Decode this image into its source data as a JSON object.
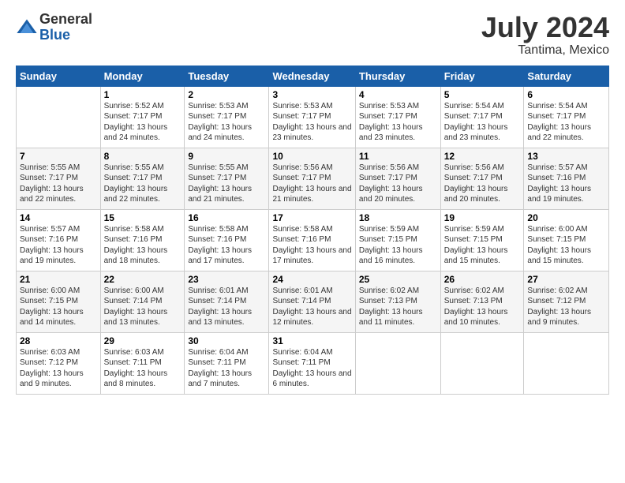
{
  "logo": {
    "general": "General",
    "blue": "Blue"
  },
  "title": {
    "month_year": "July 2024",
    "location": "Tantima, Mexico"
  },
  "headers": [
    "Sunday",
    "Monday",
    "Tuesday",
    "Wednesday",
    "Thursday",
    "Friday",
    "Saturday"
  ],
  "weeks": [
    [
      {
        "day": "",
        "sunrise": "",
        "sunset": "",
        "daylight": ""
      },
      {
        "day": "1",
        "sunrise": "Sunrise: 5:52 AM",
        "sunset": "Sunset: 7:17 PM",
        "daylight": "Daylight: 13 hours and 24 minutes."
      },
      {
        "day": "2",
        "sunrise": "Sunrise: 5:53 AM",
        "sunset": "Sunset: 7:17 PM",
        "daylight": "Daylight: 13 hours and 24 minutes."
      },
      {
        "day": "3",
        "sunrise": "Sunrise: 5:53 AM",
        "sunset": "Sunset: 7:17 PM",
        "daylight": "Daylight: 13 hours and 23 minutes."
      },
      {
        "day": "4",
        "sunrise": "Sunrise: 5:53 AM",
        "sunset": "Sunset: 7:17 PM",
        "daylight": "Daylight: 13 hours and 23 minutes."
      },
      {
        "day": "5",
        "sunrise": "Sunrise: 5:54 AM",
        "sunset": "Sunset: 7:17 PM",
        "daylight": "Daylight: 13 hours and 23 minutes."
      },
      {
        "day": "6",
        "sunrise": "Sunrise: 5:54 AM",
        "sunset": "Sunset: 7:17 PM",
        "daylight": "Daylight: 13 hours and 22 minutes."
      }
    ],
    [
      {
        "day": "7",
        "sunrise": "Sunrise: 5:55 AM",
        "sunset": "Sunset: 7:17 PM",
        "daylight": "Daylight: 13 hours and 22 minutes."
      },
      {
        "day": "8",
        "sunrise": "Sunrise: 5:55 AM",
        "sunset": "Sunset: 7:17 PM",
        "daylight": "Daylight: 13 hours and 22 minutes."
      },
      {
        "day": "9",
        "sunrise": "Sunrise: 5:55 AM",
        "sunset": "Sunset: 7:17 PM",
        "daylight": "Daylight: 13 hours and 21 minutes."
      },
      {
        "day": "10",
        "sunrise": "Sunrise: 5:56 AM",
        "sunset": "Sunset: 7:17 PM",
        "daylight": "Daylight: 13 hours and 21 minutes."
      },
      {
        "day": "11",
        "sunrise": "Sunrise: 5:56 AM",
        "sunset": "Sunset: 7:17 PM",
        "daylight": "Daylight: 13 hours and 20 minutes."
      },
      {
        "day": "12",
        "sunrise": "Sunrise: 5:56 AM",
        "sunset": "Sunset: 7:17 PM",
        "daylight": "Daylight: 13 hours and 20 minutes."
      },
      {
        "day": "13",
        "sunrise": "Sunrise: 5:57 AM",
        "sunset": "Sunset: 7:16 PM",
        "daylight": "Daylight: 13 hours and 19 minutes."
      }
    ],
    [
      {
        "day": "14",
        "sunrise": "Sunrise: 5:57 AM",
        "sunset": "Sunset: 7:16 PM",
        "daylight": "Daylight: 13 hours and 19 minutes."
      },
      {
        "day": "15",
        "sunrise": "Sunrise: 5:58 AM",
        "sunset": "Sunset: 7:16 PM",
        "daylight": "Daylight: 13 hours and 18 minutes."
      },
      {
        "day": "16",
        "sunrise": "Sunrise: 5:58 AM",
        "sunset": "Sunset: 7:16 PM",
        "daylight": "Daylight: 13 hours and 17 minutes."
      },
      {
        "day": "17",
        "sunrise": "Sunrise: 5:58 AM",
        "sunset": "Sunset: 7:16 PM",
        "daylight": "Daylight: 13 hours and 17 minutes."
      },
      {
        "day": "18",
        "sunrise": "Sunrise: 5:59 AM",
        "sunset": "Sunset: 7:15 PM",
        "daylight": "Daylight: 13 hours and 16 minutes."
      },
      {
        "day": "19",
        "sunrise": "Sunrise: 5:59 AM",
        "sunset": "Sunset: 7:15 PM",
        "daylight": "Daylight: 13 hours and 15 minutes."
      },
      {
        "day": "20",
        "sunrise": "Sunrise: 6:00 AM",
        "sunset": "Sunset: 7:15 PM",
        "daylight": "Daylight: 13 hours and 15 minutes."
      }
    ],
    [
      {
        "day": "21",
        "sunrise": "Sunrise: 6:00 AM",
        "sunset": "Sunset: 7:15 PM",
        "daylight": "Daylight: 13 hours and 14 minutes."
      },
      {
        "day": "22",
        "sunrise": "Sunrise: 6:00 AM",
        "sunset": "Sunset: 7:14 PM",
        "daylight": "Daylight: 13 hours and 13 minutes."
      },
      {
        "day": "23",
        "sunrise": "Sunrise: 6:01 AM",
        "sunset": "Sunset: 7:14 PM",
        "daylight": "Daylight: 13 hours and 13 minutes."
      },
      {
        "day": "24",
        "sunrise": "Sunrise: 6:01 AM",
        "sunset": "Sunset: 7:14 PM",
        "daylight": "Daylight: 13 hours and 12 minutes."
      },
      {
        "day": "25",
        "sunrise": "Sunrise: 6:02 AM",
        "sunset": "Sunset: 7:13 PM",
        "daylight": "Daylight: 13 hours and 11 minutes."
      },
      {
        "day": "26",
        "sunrise": "Sunrise: 6:02 AM",
        "sunset": "Sunset: 7:13 PM",
        "daylight": "Daylight: 13 hours and 10 minutes."
      },
      {
        "day": "27",
        "sunrise": "Sunrise: 6:02 AM",
        "sunset": "Sunset: 7:12 PM",
        "daylight": "Daylight: 13 hours and 9 minutes."
      }
    ],
    [
      {
        "day": "28",
        "sunrise": "Sunrise: 6:03 AM",
        "sunset": "Sunset: 7:12 PM",
        "daylight": "Daylight: 13 hours and 9 minutes."
      },
      {
        "day": "29",
        "sunrise": "Sunrise: 6:03 AM",
        "sunset": "Sunset: 7:11 PM",
        "daylight": "Daylight: 13 hours and 8 minutes."
      },
      {
        "day": "30",
        "sunrise": "Sunrise: 6:04 AM",
        "sunset": "Sunset: 7:11 PM",
        "daylight": "Daylight: 13 hours and 7 minutes."
      },
      {
        "day": "31",
        "sunrise": "Sunrise: 6:04 AM",
        "sunset": "Sunset: 7:11 PM",
        "daylight": "Daylight: 13 hours and 6 minutes."
      },
      {
        "day": "",
        "sunrise": "",
        "sunset": "",
        "daylight": ""
      },
      {
        "day": "",
        "sunrise": "",
        "sunset": "",
        "daylight": ""
      },
      {
        "day": "",
        "sunrise": "",
        "sunset": "",
        "daylight": ""
      }
    ]
  ]
}
